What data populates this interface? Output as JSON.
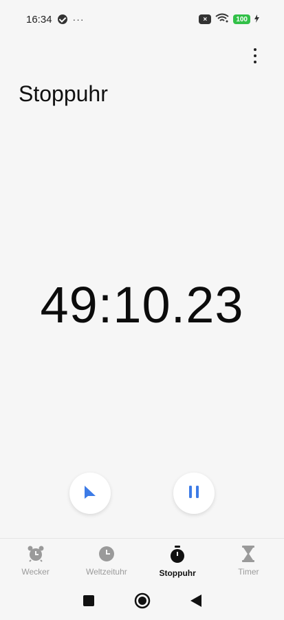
{
  "status_bar": {
    "time": "16:34",
    "overflow": "···",
    "battery": "100",
    "sim_badge": "×"
  },
  "header": {
    "title": "Stoppuhr"
  },
  "stopwatch": {
    "elapsed": "49:10.23"
  },
  "colors": {
    "accent": "#3d7be6",
    "background": "#f6f6f6",
    "inactive": "#9a9a9a",
    "battery": "#32c048"
  },
  "controls": {
    "lap_icon": "flag-icon",
    "pause_icon": "pause-icon"
  },
  "bottom_nav": {
    "items": [
      {
        "label": "Wecker",
        "icon": "alarm-clock-icon"
      },
      {
        "label": "Weltzeituhr",
        "icon": "clock-icon"
      },
      {
        "label": "Stoppuhr",
        "icon": "stopwatch-icon"
      },
      {
        "label": "Timer",
        "icon": "hourglass-icon"
      }
    ],
    "active": "Stoppuhr"
  }
}
